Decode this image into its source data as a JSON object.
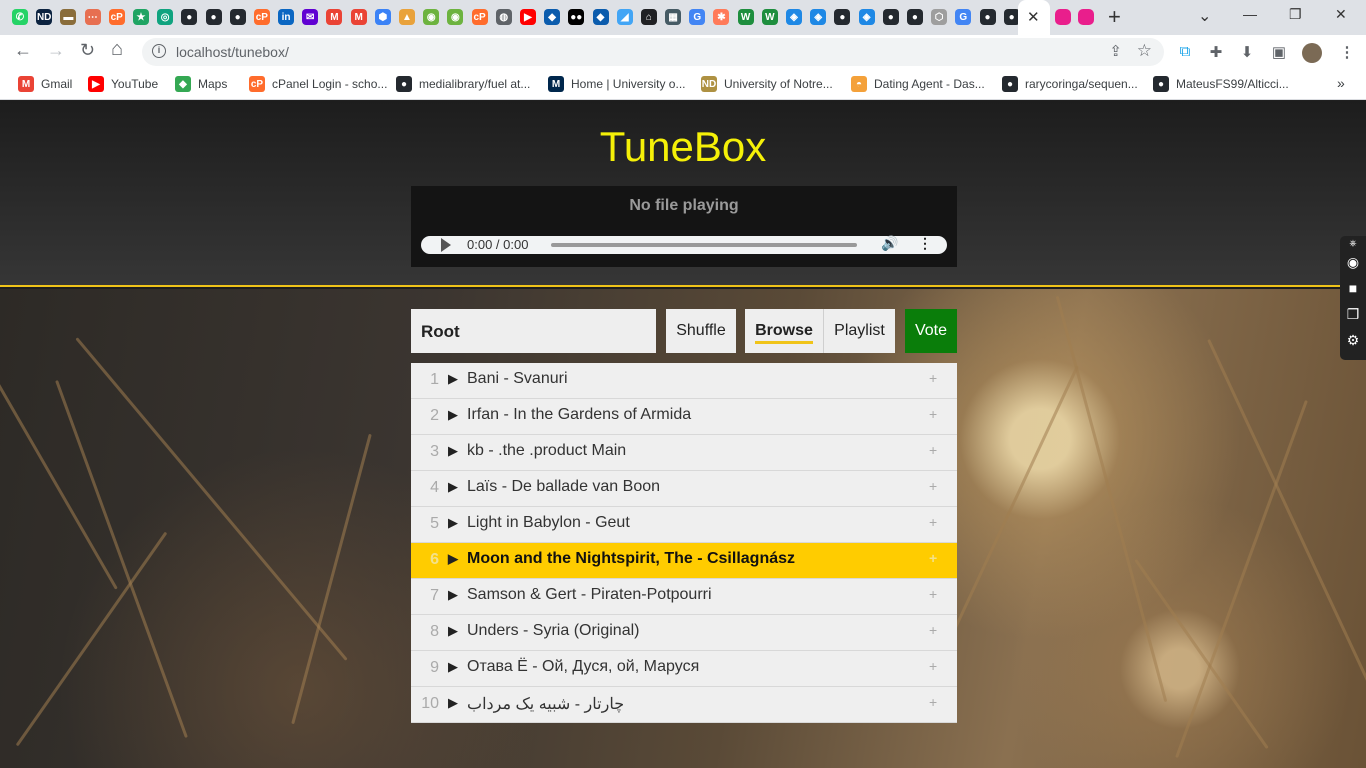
{
  "browser": {
    "url": "localhost/tunebox/",
    "close_glyph": "✕",
    "new_tab_glyph": "+",
    "window": {
      "minimize": "⌄",
      "restore": "—",
      "maximize": "❐",
      "close": "✕"
    },
    "tab_favicons": [
      {
        "icon": "whatsapp-icon",
        "color": "#25d366",
        "glyph": "✆"
      },
      {
        "icon": "notre-dame-icon",
        "color": "#0c2340",
        "glyph": "ND"
      },
      {
        "icon": "doc-icon",
        "color": "#8a6d3b",
        "glyph": "▬"
      },
      {
        "icon": "dots-icon",
        "color": "#e76f51",
        "glyph": "⋯"
      },
      {
        "icon": "cpanel-icon",
        "color": "#ff6c2c",
        "glyph": "cP"
      },
      {
        "icon": "star-icon",
        "color": "#1fa463",
        "glyph": "★"
      },
      {
        "icon": "openai-icon",
        "color": "#10a37f",
        "glyph": "◎"
      },
      {
        "icon": "github-icon",
        "color": "#24292f",
        "glyph": "●"
      },
      {
        "icon": "github-icon",
        "color": "#24292f",
        "glyph": "●"
      },
      {
        "icon": "github-icon",
        "color": "#24292f",
        "glyph": "●"
      },
      {
        "icon": "cpanel-icon",
        "color": "#ff6c2c",
        "glyph": "cP"
      },
      {
        "icon": "linkedin-icon",
        "color": "#0a66c2",
        "glyph": "in"
      },
      {
        "icon": "yahoo-mail-icon",
        "color": "#6001d2",
        "glyph": "✉"
      },
      {
        "icon": "gmail-icon",
        "color": "#ea4335",
        "glyph": "M"
      },
      {
        "icon": "gmail-icon",
        "color": "#ea4335",
        "glyph": "M"
      },
      {
        "icon": "cube-icon",
        "color": "#3b82f6",
        "glyph": "⬢"
      },
      {
        "icon": "jira-icon",
        "color": "#e9a23b",
        "glyph": "▲"
      },
      {
        "icon": "spring-icon",
        "color": "#6db33f",
        "glyph": "◉"
      },
      {
        "icon": "spring-icon",
        "color": "#6db33f",
        "glyph": "◉"
      },
      {
        "icon": "cpanel-icon",
        "color": "#ff6c2c",
        "glyph": "cP"
      },
      {
        "icon": "globe-icon",
        "color": "#5f6368",
        "glyph": "◍"
      },
      {
        "icon": "youtube-icon",
        "color": "#ff0000",
        "glyph": "▶"
      },
      {
        "icon": "drop-icon",
        "color": "#0b5cad",
        "glyph": "◆"
      },
      {
        "icon": "medium-icon",
        "color": "#000000",
        "glyph": "●●"
      },
      {
        "icon": "drop-icon",
        "color": "#0b5cad",
        "glyph": "◆"
      },
      {
        "icon": "flutter-icon",
        "color": "#42a5f5",
        "glyph": "◢"
      },
      {
        "icon": "home-icon",
        "color": "#202124",
        "glyph": "⌂"
      },
      {
        "icon": "institution-icon",
        "color": "#455a64",
        "glyph": "▦"
      },
      {
        "icon": "google-icon",
        "color": "#4285f4",
        "glyph": "G"
      },
      {
        "icon": "hubspot-icon",
        "color": "#ff7a59",
        "glyph": "✱"
      },
      {
        "icon": "webflow-icon",
        "color": "#1e8e3e",
        "glyph": "W"
      },
      {
        "icon": "webflow-icon",
        "color": "#1e8e3e",
        "glyph": "W"
      },
      {
        "icon": "vuetify-icon",
        "color": "#1e88e5",
        "glyph": "◈"
      },
      {
        "icon": "vuetify-icon",
        "color": "#1e88e5",
        "glyph": "◈"
      },
      {
        "icon": "github-icon",
        "color": "#24292f",
        "glyph": "●"
      },
      {
        "icon": "vuetify-icon",
        "color": "#1e88e5",
        "glyph": "◈"
      },
      {
        "icon": "github-icon",
        "color": "#24292f",
        "glyph": "●"
      },
      {
        "icon": "github-icon",
        "color": "#24292f",
        "glyph": "●"
      },
      {
        "icon": "box-icon",
        "color": "#9e9e9e",
        "glyph": "⬡"
      },
      {
        "icon": "google-icon",
        "color": "#4285f4",
        "glyph": "G"
      },
      {
        "icon": "github-icon",
        "color": "#24292f",
        "glyph": "●"
      },
      {
        "icon": "github-icon",
        "color": "#24292f",
        "glyph": "●"
      },
      {
        "icon": "drupal-icon",
        "color": "#0678be",
        "glyph": "💧"
      }
    ],
    "after_tabs": [
      {
        "icon": "app-icon",
        "color": "#e91e8c",
        "glyph": "◙"
      },
      {
        "icon": "app-icon",
        "color": "#e91e8c",
        "glyph": "◙"
      }
    ],
    "toolbar_icons": {
      "back": "←",
      "forward": "→",
      "reload": "↻",
      "home": "⌂",
      "info": "i",
      "share": "⇪",
      "star": "☆",
      "extension_a": "⧉",
      "puzzle": "✚",
      "download": "⬇",
      "sidepanel": "▣"
    },
    "bookmarks": [
      {
        "label": "Gmail",
        "icon": "gmail-icon",
        "color": "#ea4335",
        "glyph": "M"
      },
      {
        "label": "YouTube",
        "icon": "youtube-icon",
        "color": "#ff0000",
        "glyph": "▶"
      },
      {
        "label": "Maps",
        "icon": "maps-icon",
        "color": "#34a853",
        "glyph": "◆"
      },
      {
        "label": "cPanel Login - scho...",
        "icon": "cpanel-icon",
        "color": "#ff6c2c",
        "glyph": "cP"
      },
      {
        "label": "medialibrary/fuel at...",
        "icon": "github-icon",
        "color": "#24292f",
        "glyph": "●"
      },
      {
        "label": "Home | University o...",
        "icon": "michigan-icon",
        "color": "#00274c",
        "glyph": "M"
      },
      {
        "label": "University of Notre...",
        "icon": "notre-dame-icon",
        "color": "#ae9142",
        "glyph": "ND"
      },
      {
        "label": "Dating Agent - Das...",
        "icon": "agent-icon",
        "color": "#f4a13a",
        "glyph": "◓"
      },
      {
        "label": "rarycoringa/sequen...",
        "icon": "github-icon",
        "color": "#24292f",
        "glyph": "●"
      },
      {
        "label": "MateusFS99/Alticci...",
        "icon": "github-icon",
        "color": "#24292f",
        "glyph": "●"
      }
    ],
    "bookmarks_more": "»"
  },
  "app": {
    "title": "TuneBox",
    "now_playing": "No file playing",
    "audio_time": "0:00 / 0:00",
    "audio_icons": {
      "play": "play-icon",
      "volume": "🔊",
      "menu": "⋮"
    },
    "path_label": "Root",
    "buttons": {
      "shuffle": "Shuffle",
      "browse": "Browse",
      "playlist": "Playlist",
      "vote": "Vote"
    },
    "row_glyphs": {
      "play": "▶",
      "add": "+"
    },
    "tracks": [
      {
        "num": "1",
        "name": "Bani - Svanuri"
      },
      {
        "num": "2",
        "name": "Irfan - In the Gardens of Armida"
      },
      {
        "num": "3",
        "name": "kb - .the .product Main"
      },
      {
        "num": "4",
        "name": "Laïs - De ballade van Boon"
      },
      {
        "num": "5",
        "name": "Light in Babylon - Geut"
      },
      {
        "num": "6",
        "name": "Moon and the Nightspirit, The - Csillagnász"
      },
      {
        "num": "7",
        "name": "Samson & Gert - Piraten-Potpourri"
      },
      {
        "num": "8",
        "name": "Unders - Syria (Original)"
      },
      {
        "num": "9",
        "name": "Отава Ё - Ой, Дуся, ой, Маруся"
      },
      {
        "num": "10",
        "name": "چارتار - شبیه یک مرداب"
      }
    ],
    "selected_track_index": 5,
    "colors": {
      "title": "#f5f008",
      "accent": "#f0c419",
      "selected_row": "#ffcc00",
      "vote_button": "#0a7d0a"
    },
    "side_widget_icons": [
      "camera-icon",
      "video-icon",
      "copy-icon",
      "settings-icon"
    ]
  }
}
